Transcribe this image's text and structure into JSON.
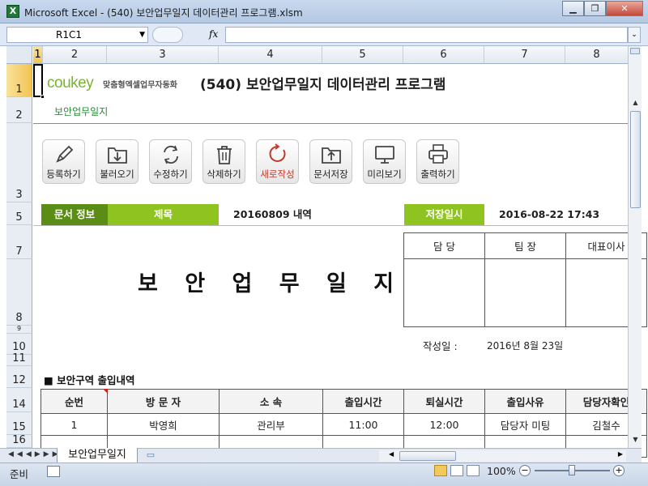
{
  "window": {
    "title": "Microsoft Excel - (540) 보안업무일지 데이터관리 프로그램.xlsm",
    "app_icon": "X"
  },
  "formula_bar": {
    "name_box": "R1C1",
    "fx": "fx",
    "value": ""
  },
  "columns": [
    "1",
    "2",
    "3",
    "4",
    "5",
    "6",
    "7",
    "8"
  ],
  "rows": [
    "1",
    "2",
    "3",
    "5",
    "7",
    "8",
    "9",
    "10",
    "11",
    "12",
    "14",
    "15",
    "16"
  ],
  "header": {
    "logo": "coukey",
    "logo_sub": "맞춤형엑셀업무자동화",
    "title": "(540) 보안업무일지 데이터관리 프로그램",
    "subtitle": "보안업무일지"
  },
  "toolbar": [
    {
      "label": "등록하기",
      "icon": "pencil-icon"
    },
    {
      "label": "불러오기",
      "icon": "download-icon"
    },
    {
      "label": "수정하기",
      "icon": "refresh-icon"
    },
    {
      "label": "삭제하기",
      "icon": "trash-icon"
    },
    {
      "label": "새로작성",
      "icon": "new-icon",
      "color": "#c0392b"
    },
    {
      "label": "문서저장",
      "icon": "folder-upload-icon"
    },
    {
      "label": "미리보기",
      "icon": "monitor-icon"
    },
    {
      "label": "출력하기",
      "icon": "printer-icon"
    }
  ],
  "info": {
    "doc_info_label": "문서 정보",
    "title_label": "제목",
    "title_value": "20160809 내역",
    "saved_label": "저장일시",
    "saved_value": "2016-08-22 17:43",
    "colors": {
      "dark_green": "#5b8c16",
      "light_green": "#8fc31f"
    }
  },
  "document": {
    "title": "보 안 업 무 일 지"
  },
  "approval": {
    "headers": [
      "담 당",
      "팀 장",
      "대표이사"
    ]
  },
  "written": {
    "label": "작성일 :",
    "value": "2016년 8월 23일"
  },
  "visitor_list": {
    "title": "■ 보안구역 출입내역",
    "columns": [
      "순번",
      "방 문 자",
      "소 속",
      "출입시간",
      "퇴실시간",
      "출입사유",
      "담당자확인"
    ],
    "rows": [
      [
        "1",
        "박영희",
        "관리부",
        "11:00",
        "12:00",
        "담당자 미팅",
        "김철수"
      ]
    ]
  },
  "sheet_tabs": {
    "active": "보안업무일지"
  },
  "status": {
    "ready": "준비",
    "zoom": "100%"
  }
}
